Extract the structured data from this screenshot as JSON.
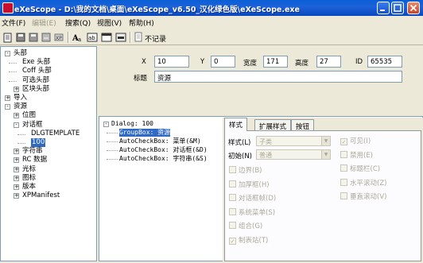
{
  "window": {
    "title": "eXeScope  -  D:\\我的文档\\桌面\\eXeScope_v6.50_汉化绿色版\\eXeScope.exe"
  },
  "menu": {
    "file": "文件(F)",
    "edit": "编辑(E)",
    "search": "搜索(Q)",
    "view": "视图(V)",
    "help": "帮助(H)"
  },
  "toolbar": {
    "icons": [
      "open-icon",
      "save-icon",
      "save-as-icon",
      "export-icon",
      "import-icon",
      "font-icon",
      "text-icon",
      "dialog-icon",
      "form-icon",
      "nolog-icon"
    ],
    "nolog_label": "不记录"
  },
  "tree": {
    "items": [
      {
        "label": "头部",
        "level": 0,
        "expander": "-"
      },
      {
        "label": "Exe 头部",
        "level": 1
      },
      {
        "label": "Coff 头部",
        "level": 1
      },
      {
        "label": "可选头部",
        "level": 1
      },
      {
        "label": "区块头部",
        "level": 1,
        "expander": "+"
      },
      {
        "label": "导入",
        "level": 0,
        "expander": "+"
      },
      {
        "label": "资源",
        "level": 0,
        "expander": "-"
      },
      {
        "label": "位图",
        "level": 1,
        "expander": "+"
      },
      {
        "label": "对话框",
        "level": 1,
        "expander": "-"
      },
      {
        "label": "DLGTEMPLATE",
        "level": 2
      },
      {
        "label": "100",
        "level": 2,
        "selected": true
      },
      {
        "label": "字符串",
        "level": 1,
        "expander": "+"
      },
      {
        "label": "RC 数据",
        "level": 1,
        "expander": "+"
      },
      {
        "label": "光标",
        "level": 1,
        "expander": "+"
      },
      {
        "label": "图标",
        "level": 1,
        "expander": "+"
      },
      {
        "label": "版本",
        "level": 1,
        "expander": "+"
      },
      {
        "label": "XPManifest",
        "level": 1,
        "expander": "+"
      }
    ]
  },
  "props": {
    "x_label": "X",
    "x_value": "10",
    "y_label": "Y",
    "y_value": "0",
    "width_label": "宽度",
    "width_value": "171",
    "height_label": "高度",
    "height_value": "27",
    "id_label": "ID",
    "id_value": "65535",
    "caption_label": "标题",
    "caption_value": "资源"
  },
  "dialog_tree": {
    "items": [
      {
        "label": "Dialog: 100",
        "expander": "-"
      },
      {
        "label": "GroupBox: 资源",
        "selected": true
      },
      {
        "label": "AutoCheckBox: 菜单(&M)"
      },
      {
        "label": "AutoCheckBox: 对话框(&D)"
      },
      {
        "label": "AutoCheckBox: 字符串(&S)"
      }
    ]
  },
  "tabs": [
    "样式",
    "扩展样式",
    "按钮"
  ],
  "style_tab": {
    "style_label": "样式(L)",
    "style_value": "子类",
    "init_label": "初始(N)",
    "init_value": "普通",
    "left_checks": [
      {
        "label": "边界(B)",
        "checked": false
      },
      {
        "label": "加厚框(H)",
        "checked": false
      },
      {
        "label": "对话框帧(D)",
        "checked": false
      },
      {
        "label": "系统菜单(S)",
        "checked": false
      },
      {
        "label": "组合(G)",
        "checked": false
      },
      {
        "label": "制表站(T)",
        "checked": true
      }
    ],
    "right_checks": [
      {
        "label": "可见(I)",
        "checked": true
      },
      {
        "label": "禁用(E)",
        "checked": false
      },
      {
        "label": "标题栏(C)",
        "checked": false
      },
      {
        "label": "水平滚动(Z)",
        "checked": false
      },
      {
        "label": "垂直滚动(V)",
        "checked": false
      }
    ]
  }
}
